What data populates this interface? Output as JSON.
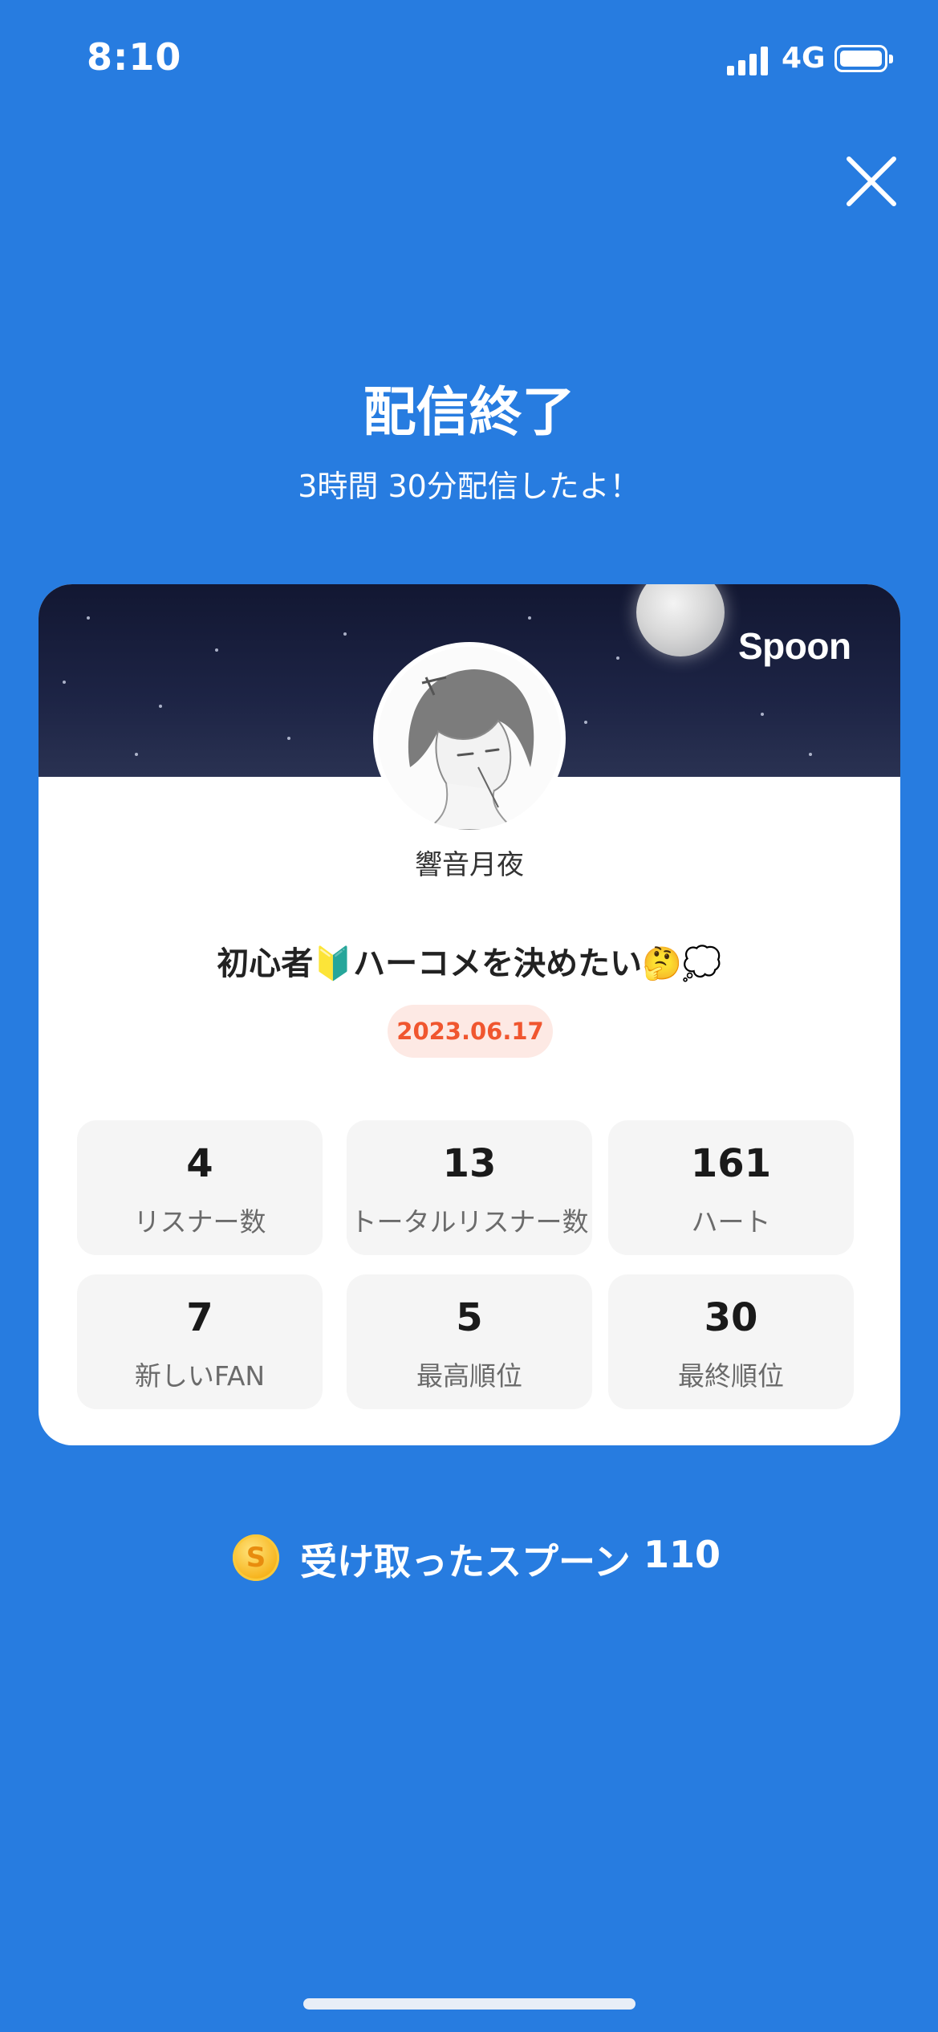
{
  "status_bar": {
    "time": "8:10",
    "network": "4G"
  },
  "header": {
    "title": "配信終了",
    "subtitle": "3時間 30分配信したよ！"
  },
  "card": {
    "brand": "Spoon",
    "username": "響音月夜",
    "broadcast_title": "初心者🔰ハーコメを決めたい🤔💭",
    "date": "2023.06.17",
    "stats": [
      {
        "value": "4",
        "label": "リスナー数"
      },
      {
        "value": "13",
        "label": "トータルリスナー数"
      },
      {
        "value": "161",
        "label": "ハート"
      },
      {
        "value": "7",
        "label": "新しいFAN"
      },
      {
        "value": "5",
        "label": "最高順位"
      },
      {
        "value": "30",
        "label": "最終順位"
      }
    ]
  },
  "spoons": {
    "coin_symbol": "S",
    "label": "受け取ったスプーン",
    "count": "110"
  },
  "colors": {
    "background": "#277ce0",
    "date_badge_bg": "#fde9e4",
    "date_badge_text": "#f0562f",
    "coin": "#f6b21a"
  }
}
